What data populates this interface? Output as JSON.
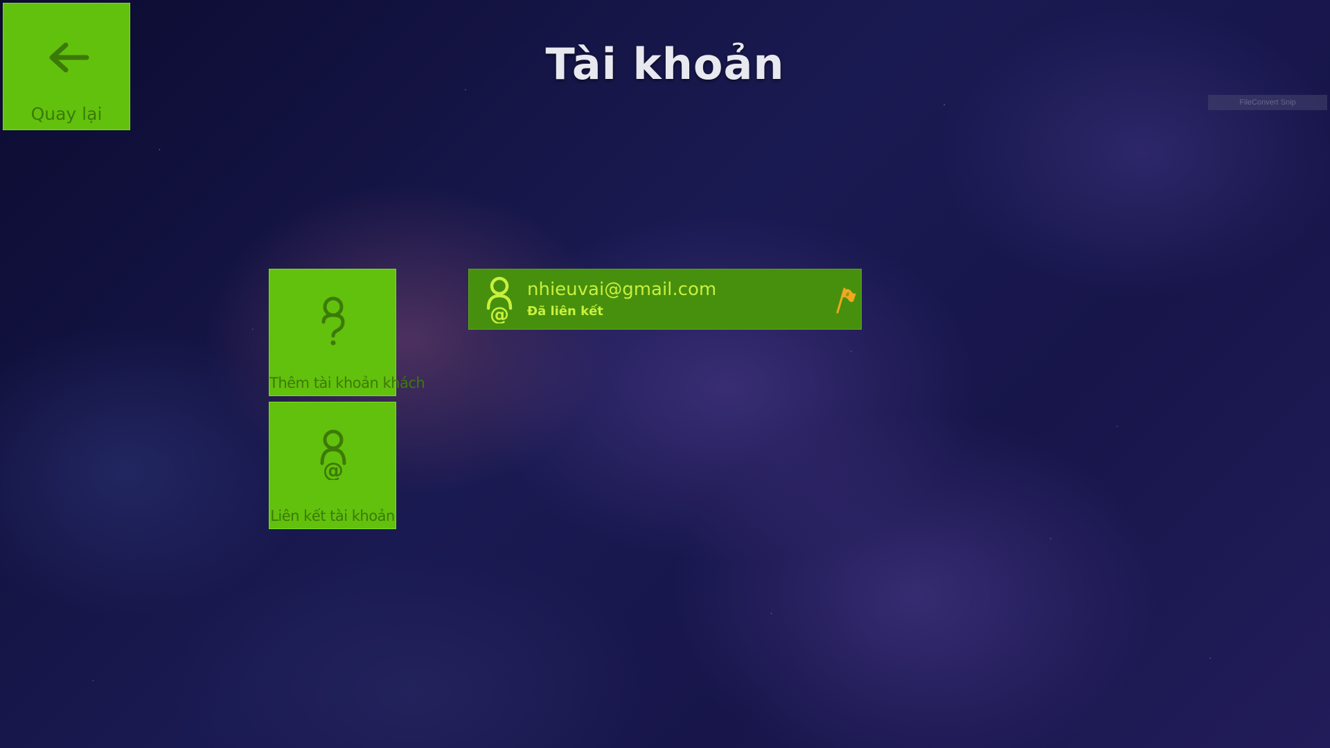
{
  "header": {
    "title": "Tài khoản",
    "watermark": "FileConvert Snip"
  },
  "back": {
    "label": "Quay lại",
    "icon": "arrow-left-icon"
  },
  "tiles": [
    {
      "label": "Thêm tài khoản khách",
      "icon": "guest-user-icon"
    },
    {
      "label": "Liên kết tài khoản",
      "icon": "link-account-icon"
    }
  ],
  "account": {
    "email": "nhieuvai@gmail.com",
    "status": "Đã liên kết",
    "avatar_icon": "account-email-icon",
    "flag_icon": "report-flag-icon"
  },
  "colors": {
    "tile_green": "#62c10c",
    "tile_text": "#3c7a08",
    "card_green": "#47900e",
    "card_text": "#c8f03c",
    "flag": "#f2a81e"
  }
}
